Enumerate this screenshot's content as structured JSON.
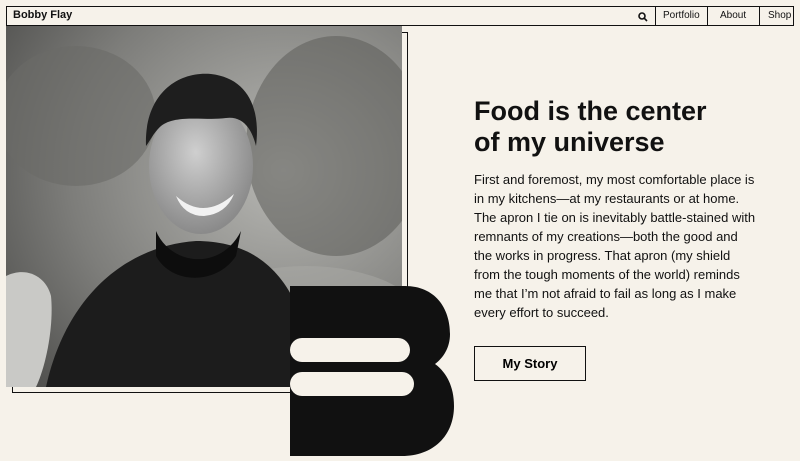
{
  "header": {
    "brand": "Bobby Flay",
    "search_icon": "search-icon",
    "nav": [
      {
        "label": "Portfolio"
      },
      {
        "label": "About"
      },
      {
        "label": "Shop"
      }
    ]
  },
  "hero": {
    "photo_icon": "portrait-photo",
    "logo_icon": "b-monogram",
    "title_line1": "Food is the center",
    "title_line2": "of my universe",
    "body": "First and foremost, my most comfortable place is in my kitchens—at my restaurants or at home. The apron I tie on is inevitably battle-stained with remnants of my creations—both the good and the works in progress. That apron (my shield from the tough moments of the world) reminds me that I’m not afraid to fail as long as I make every effort to succeed.",
    "cta_label": "My Story"
  },
  "colors": {
    "background": "#f6f2ea",
    "ink": "#111111"
  }
}
